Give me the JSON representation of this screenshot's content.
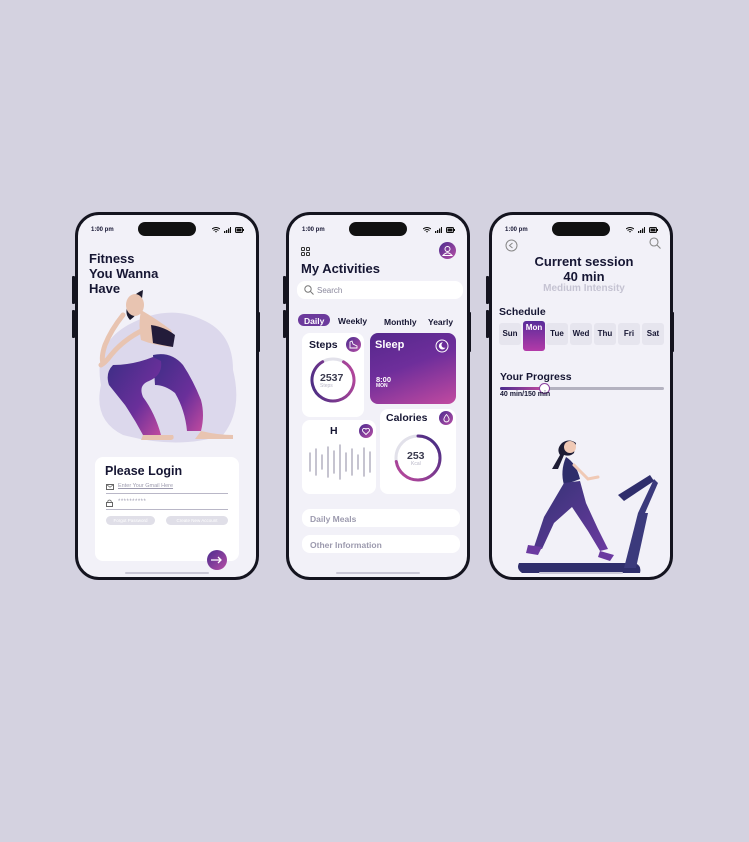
{
  "status_time": "1:00 pm",
  "login": {
    "headline": [
      "Fitness",
      "You Wanna",
      "Have"
    ],
    "title": "Please Login",
    "email_placeholder": "Enter Your Gmail Here",
    "password_placeholder": "**********",
    "forgot_label": "Forgot Password",
    "create_label": "Create New Account"
  },
  "activities": {
    "title": "My Activities",
    "search_placeholder": "Search",
    "tabs": [
      "Daily",
      "Weekly",
      "Monthly",
      "Yearly"
    ],
    "steps": {
      "label": "Steps",
      "value": "2537",
      "unit": "Steps"
    },
    "sleep": {
      "label": "Sleep",
      "time": "8:00",
      "day": "MON"
    },
    "heart": {
      "label": "H"
    },
    "calories": {
      "label": "Calories",
      "value": "253",
      "unit": "Kcal"
    },
    "sections": [
      "Daily Meals",
      "Other Information"
    ]
  },
  "session": {
    "title_line1": "Current session",
    "title_line2": "40 min",
    "subtitle": "Medium Intensity",
    "schedule_label": "Schedule",
    "days": [
      "Sun",
      "Mon",
      "Tue",
      "Wed",
      "Thu",
      "Fri",
      "Sat"
    ],
    "selected_day": "Mon",
    "progress_label": "Your Progress",
    "progress_text": "40 min/150 min",
    "progress_fraction": 0.27
  },
  "colors": {
    "accent": "#7a3a9e",
    "accent_dark": "#3b2a7a",
    "accent_pink": "#c0449e",
    "bg": "#d4d2e0"
  }
}
